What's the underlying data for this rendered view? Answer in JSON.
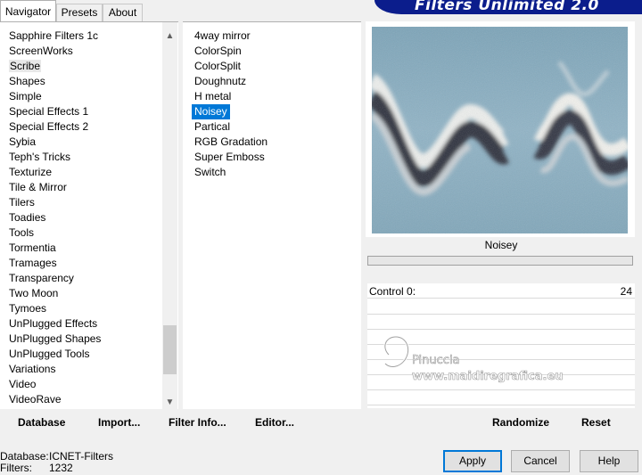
{
  "tabs": [
    {
      "label": "Navigator"
    },
    {
      "label": "Presets"
    },
    {
      "label": "About"
    }
  ],
  "banner": {
    "title": "Filters Unlimited 2.0"
  },
  "categories": {
    "items": [
      "Sapphire Filters 1c",
      "ScreenWorks",
      "Scribe",
      "Shapes",
      "Simple",
      "Special Effects 1",
      "Special Effects 2",
      "Sybia",
      "Teph's Tricks",
      "Texturize",
      "Tile & Mirror",
      "Tilers",
      "Toadies",
      "Tools",
      "Tormentia",
      "Tramages",
      "Transparency",
      "Two Moon",
      "Tymoes",
      "UnPlugged Effects",
      "UnPlugged Shapes",
      "UnPlugged Tools",
      "Variations",
      "Video",
      "VideoRave"
    ],
    "selected": "Scribe"
  },
  "filters": {
    "items": [
      "4way mirror",
      "ColorSpin",
      "ColorSplit",
      "Doughnutz",
      "H metal",
      "Noisey",
      "Partical",
      "RGB Gradation",
      "Super Emboss",
      "Switch"
    ],
    "selected": "Noisey"
  },
  "preview": {
    "filter_name": "Noisey"
  },
  "controls": [
    {
      "label": "Control 0:",
      "value": "24"
    }
  ],
  "watermark": {
    "line1": "Pinuccia",
    "line2": "www.maidiregrafica.eu"
  },
  "toolbar_left": {
    "database": "Database",
    "import": "Import...",
    "filter_info": "Filter Info...",
    "editor": "Editor..."
  },
  "toolbar_right": {
    "randomize": "Randomize",
    "reset": "Reset"
  },
  "status": {
    "database_label": "Database:",
    "database_value": "ICNET-Filters",
    "filters_label": "Filters:",
    "filters_value": "1232"
  },
  "buttons": {
    "apply": "Apply",
    "cancel": "Cancel",
    "help": "Help"
  },
  "colors": {
    "selection": "#0078d7",
    "banner": "#0b1d8c"
  }
}
